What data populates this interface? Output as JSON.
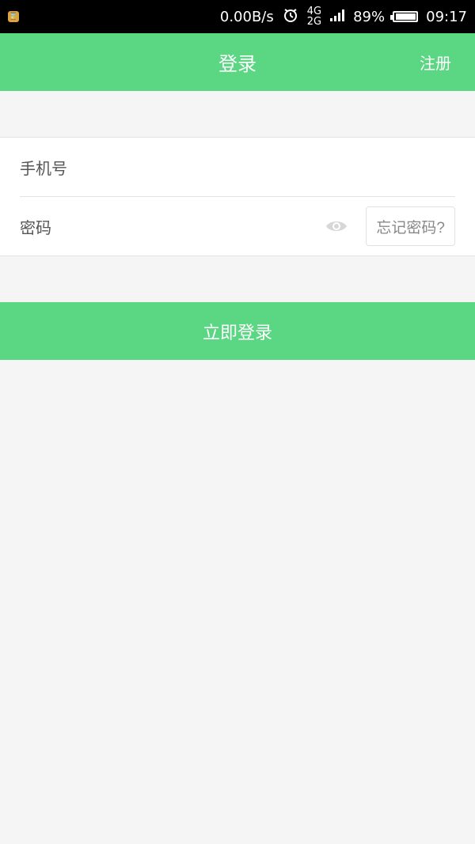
{
  "status_bar": {
    "app_icon_label": "⌛",
    "speed": "0.00B/s",
    "network_top": "4G",
    "network_bottom": "2G",
    "battery": "89%",
    "time": "09:17"
  },
  "navbar": {
    "title": "登录",
    "register": "注册"
  },
  "form": {
    "phone_label": "手机号",
    "phone_value": "",
    "password_label": "密码",
    "password_value": "",
    "forgot_password": "忘记密码?"
  },
  "actions": {
    "login_button": "立即登录"
  },
  "colors": {
    "brand": "#5bd683",
    "page_bg": "#f5f5f5"
  }
}
